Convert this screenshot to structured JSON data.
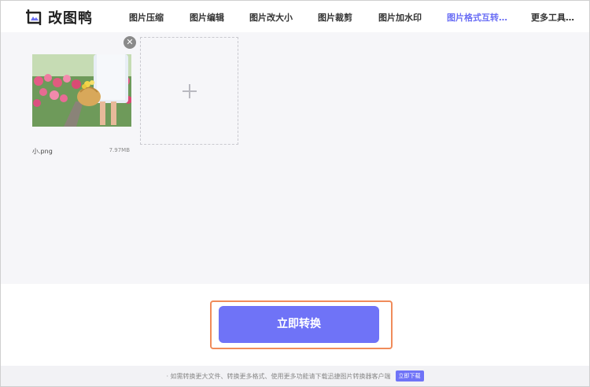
{
  "header": {
    "logo_text": "改图鸭",
    "nav": [
      {
        "label": "图片压缩"
      },
      {
        "label": "图片编辑"
      },
      {
        "label": "图片改大小"
      },
      {
        "label": "图片裁剪"
      },
      {
        "label": "图片加水印"
      },
      {
        "label": "图片格式互转…"
      },
      {
        "label": "更多工具…"
      }
    ],
    "active_index": 5,
    "accent_color": "#6b6ff5"
  },
  "files": [
    {
      "name": "小.png",
      "size": "7.97MB"
    }
  ],
  "actions": {
    "convert_label": "立即转换",
    "button_color": "#6f73f7",
    "highlight_color": "#f08b5a"
  },
  "footer": {
    "text": "· 如需转换更大文件、转换更多格式、使用更多功能请下载迅捷图片转换器客户端",
    "download_label": "立即下载"
  }
}
